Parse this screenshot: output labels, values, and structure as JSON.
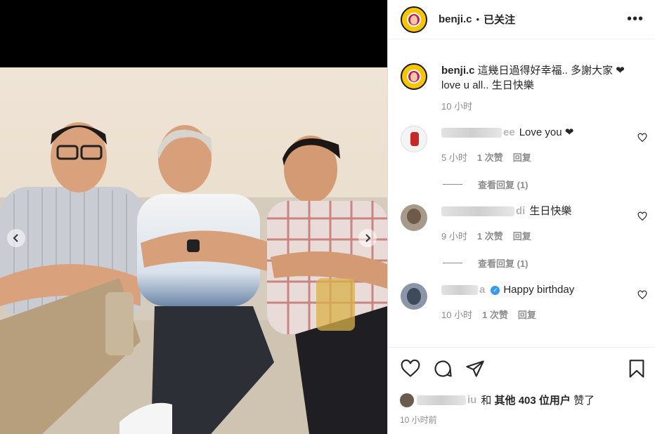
{
  "post": {
    "username": "benji.c",
    "follow_status": "已关注",
    "more_label": "•••"
  },
  "caption": {
    "username": "benji.c",
    "text": "這幾日過得好幸福.. 多謝大家 ❤",
    "text2": "love u all.. 生日快樂",
    "time": "10 小时"
  },
  "comments": [
    {
      "username": "ee",
      "text": "Love you ❤",
      "time": "5 小时",
      "likes": "1 次赞",
      "reply": "回复",
      "view_replies": "查看回复 (1)"
    },
    {
      "username": "di",
      "text": "生日快樂",
      "time": "9 小时",
      "likes": "1 次赞",
      "reply": "回复",
      "view_replies": "查看回复 (1)"
    },
    {
      "username": "a",
      "text": "Happy birthday",
      "time": "10 小时",
      "likes": "1 次赞",
      "reply": "回复"
    }
  ],
  "likes": {
    "liker": "iu",
    "and": "和",
    "others": "其他 403 位用户",
    "liked": "赞了"
  },
  "post_time": "10 小时前",
  "icons": [
    "heart-icon",
    "comment-icon",
    "share-icon",
    "bookmark-icon",
    "chevron-left-icon",
    "chevron-right-icon",
    "verified-icon"
  ],
  "colors": {
    "like_red": "#e0245e",
    "verified_blue": "#3897f0",
    "muted": "#8e8e8e"
  }
}
